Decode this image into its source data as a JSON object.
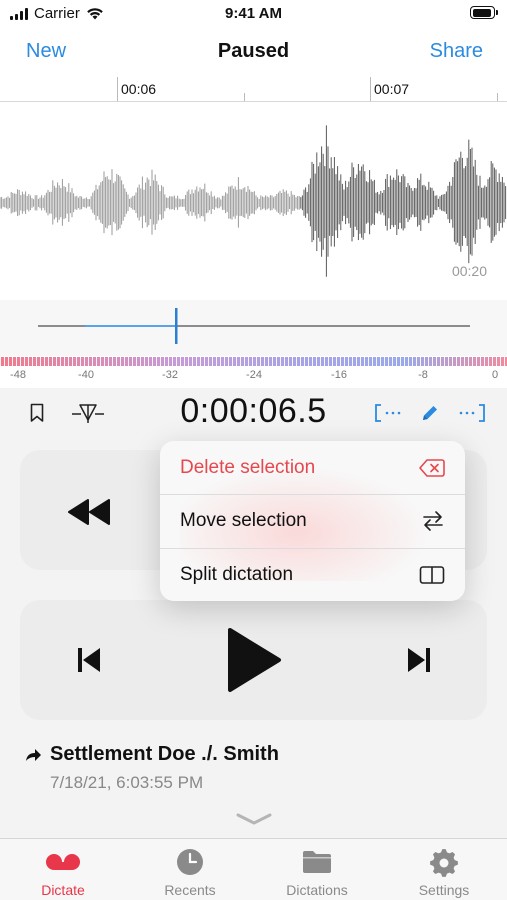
{
  "status_bar": {
    "carrier": "Carrier",
    "time": "9:41 AM",
    "battery_level": 0.95
  },
  "nav": {
    "left_label": "New",
    "title": "Paused",
    "right_label": "Share"
  },
  "timeline": {
    "labels": [
      "00:06",
      "00:07"
    ]
  },
  "waveform": {
    "time_label": "00:20"
  },
  "scrubber": {
    "progress": 0.32
  },
  "level_meter": {
    "labels": [
      "-48",
      "-40",
      "-32",
      "-24",
      "-16",
      "-8",
      "0"
    ]
  },
  "playback": {
    "time": "0:00:06.5"
  },
  "icons": {
    "bookmark": "bookmark-icon",
    "marker": "marker-icon",
    "select_start": "bracket-start-icon",
    "edit": "pencil-icon",
    "select_end": "bracket-end-icon",
    "rewind": "rewind-icon",
    "skip_back": "skip-back-icon",
    "play": "play-icon",
    "skip_forward": "skip-forward-icon",
    "share_arrow": "forward-arrow-icon",
    "expand": "chevron-down-icon"
  },
  "context_menu": {
    "items": [
      {
        "label": "Delete selection",
        "icon": "delete-left-icon",
        "style": "destructive"
      },
      {
        "label": "Move selection",
        "icon": "arrows-swap-icon"
      },
      {
        "label": "Split dictation",
        "icon": "split-icon"
      }
    ]
  },
  "recording": {
    "title": "Settlement Doe ./. Smith",
    "date": "7/18/21, 6:03:55 PM"
  },
  "tabs": [
    {
      "label": "Dictate",
      "icon": "record-icon",
      "active": true
    },
    {
      "label": "Recents",
      "icon": "clock-icon",
      "active": false
    },
    {
      "label": "Dictations",
      "icon": "folder-icon",
      "active": false
    },
    {
      "label": "Settings",
      "icon": "gear-icon",
      "active": false
    }
  ],
  "colors": {
    "accent": "#2b8be0",
    "destructive": "#e5484d",
    "tab_active": "#e8364a"
  }
}
